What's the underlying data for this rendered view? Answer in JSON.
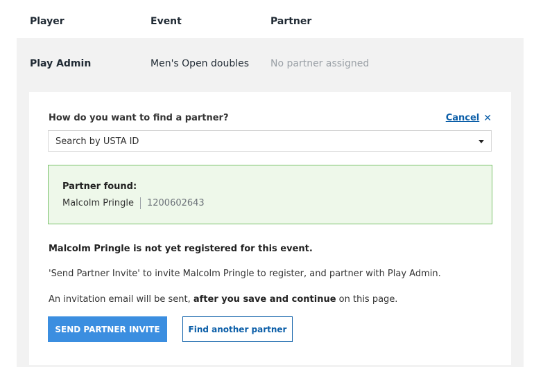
{
  "table": {
    "headers": [
      "Player",
      "Event",
      "Partner"
    ],
    "row": {
      "player": "Play Admin",
      "event": "Men's Open doubles",
      "partner": "No partner assigned"
    }
  },
  "finder": {
    "question": "How do you want to find a partner?",
    "cancel_label": "Cancel",
    "close_icon": "✕",
    "search_method": "Search by USTA ID",
    "result": {
      "title": "Partner found:",
      "name": "Malcolm Pringle",
      "usta_id": "1200602643"
    },
    "messages": {
      "not_registered": "Malcolm Pringle is not yet registered for this event.",
      "invite_info": "'Send Partner Invite' to invite Malcolm Pringle to register, and partner with Play Admin.",
      "email_prefix": "An invitation email will be sent, ",
      "email_bold": "after you save and continue",
      "email_suffix": " on this page."
    },
    "buttons": {
      "send_invite": "SEND PARTNER INVITE",
      "find_another": "Find another partner"
    }
  },
  "colors": {
    "primary": "#3b8ee0",
    "link": "#0b5ea8",
    "success_border": "#7ac26a",
    "success_bg": "#eef8ea",
    "panel_bg": "#f2f2f2"
  }
}
